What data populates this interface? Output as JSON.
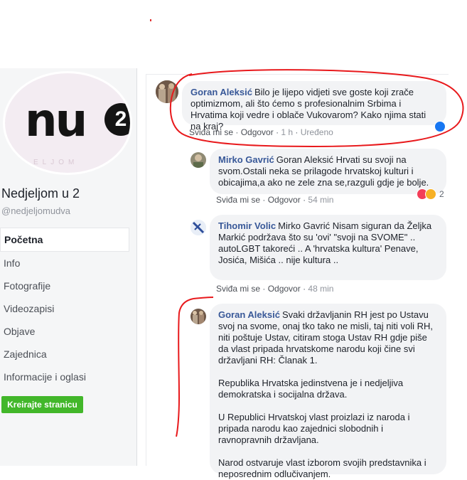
{
  "page": {
    "name": "Nedjeljom u 2",
    "handle": "@nedjeljomudva",
    "logo_text": "nu",
    "logo_badge": "2",
    "create_button": "Kreirajte stranicu"
  },
  "nav": [
    {
      "label": "Početna",
      "active": true
    },
    {
      "label": "Info"
    },
    {
      "label": "Fotografije"
    },
    {
      "label": "Videozapisi"
    },
    {
      "label": "Objave"
    },
    {
      "label": "Zajednica"
    },
    {
      "label": "Informacije i oglasi"
    }
  ],
  "comments": [
    {
      "author": "Goran Aleksić",
      "text": "Bilo je lijepo vidjeti sve goste koji zrače optimizmom, ali što ćemo s profesionalnim Srbima i Hrvatima koji vedre i oblače Vukovarom? Kako njima stati na kraj?",
      "like": "Sviđa mi se",
      "reply": "Odgovor",
      "time": "1 h",
      "edited": "Uređeno",
      "reaction_icon": "like-icon"
    },
    {
      "author": "Mirko Gavrić",
      "text": "Goran Aleksić Hrvati su svoji na svom.Ostali neka se prilagode hrvatskoj kulturi i obicajima,a ako ne zele zna se,razguli gdje je bolje.",
      "like": "Sviđa mi se",
      "reply": "Odgovor",
      "time": "54 min",
      "reaction_count": "2",
      "reaction_icons": [
        "love-icon",
        "haha-icon"
      ]
    },
    {
      "author": "Tihomir Volic",
      "text": "Mirko Gavrić Nisam siguran da Željka Markić podržava što su 'ovi' \"svoji na SVOME\" .. autoLGBT takoreći .. A 'hrvatska kultura' Penave, Josića, Mišića .. nije kultura ..",
      "like": "Sviđa mi se",
      "reply": "Odgovor",
      "time": "48 min"
    },
    {
      "author": "Goran Aleksić",
      "paragraphs": [
        "Svaki državljanin RH jest po Ustavu svoj na svome, onaj tko tako ne misli, taj niti voli RH, niti poštuje Ustav, citiram stoga Ustav RH gdje piše da vlast pripada hrvatskome narodu koji čine svi državljani RH: Članak 1.",
        "Republika Hrvatska jedinstvena je i nedjeljiva demokratska i socijalna država.",
        "U Republici Hrvatskoj vlast proizlazi iz naroda i pripada narodu kao zajednici slobodnih i ravnopravnih državljana.",
        "Narod ostvaruje vlast izborom svojih predstavnika i neposrednim odlučivanjem."
      ]
    }
  ],
  "colors": {
    "link": "#385898",
    "bubble": "#f2f3f5",
    "annotation": "#e8191c",
    "create_button": "#42b72a"
  }
}
